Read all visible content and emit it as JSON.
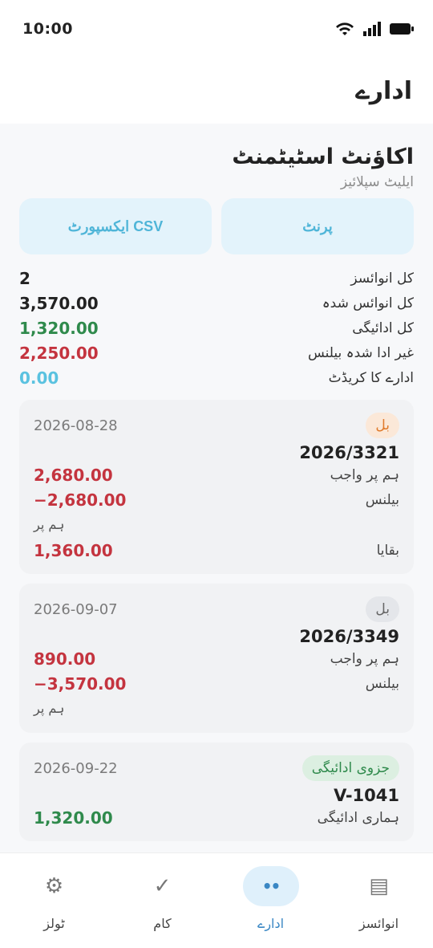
{
  "status": {
    "time": "10:00"
  },
  "app": {
    "title": "ادارے"
  },
  "statement": {
    "title": "اکاؤنٹ اسٹیٹمنٹ",
    "subtitle": "ایلیٹ سپلائیز",
    "print_label": "پرنٹ",
    "csv_label": "CSV ایکسپورٹ"
  },
  "summary": [
    {
      "label": "کل انوائسز",
      "value": "2",
      "color": "#222222"
    },
    {
      "label": "کل انوائس شدہ",
      "value": "3,570.00",
      "color": "#222222"
    },
    {
      "label": "کل ادائیگی",
      "value": "1,320.00",
      "color": "#2f8a4c"
    },
    {
      "label": "غیر ادا شدہ بیلنس",
      "value": "2,250.00",
      "color": "#c4343f"
    },
    {
      "label": "ادارے کا کریڈٹ",
      "value": "0.00",
      "color": "#5ac2e0"
    }
  ],
  "cards": [
    {
      "date": "2026-08-28",
      "badge": "بل",
      "badge_bg": "#fbe8d8",
      "badge_color": "#e07a2c",
      "number": "2026/3321",
      "rows": [
        {
          "label": "ہم پر واجب",
          "value": "2,680.00"
        },
        {
          "label": "بیلنس",
          "value": "−2,680.00"
        }
      ],
      "note": "ہم پر",
      "remaining_label": "بقایا",
      "remaining_value": "1,360.00"
    },
    {
      "date": "2026-09-07",
      "badge": "بل",
      "badge_bg": "#e4e6ea",
      "badge_color": "#666666",
      "number": "2026/3349",
      "rows": [
        {
          "label": "ہم پر واجب",
          "value": "890.00"
        },
        {
          "label": "بیلنس",
          "value": "−3,570.00"
        }
      ],
      "note": "ہم پر"
    },
    {
      "date": "2026-09-22",
      "badge": "جزوی ادائیگی",
      "badge_bg": "#dcefe1",
      "badge_color": "#2f8a4c",
      "number": "V-1041",
      "rows": [
        {
          "label": "ہماری ادائیگی",
          "value": "1,320.00"
        }
      ]
    }
  ],
  "nav": [
    {
      "label": "ٹولز",
      "icon": "gear-icon",
      "glyph": "⚙"
    },
    {
      "label": "کام",
      "icon": "check-icon",
      "glyph": "✓"
    },
    {
      "label": "ادارے",
      "icon": "entity-icon",
      "glyph": "••",
      "active": true
    },
    {
      "label": "انوائسز",
      "icon": "list-icon",
      "glyph": "▤"
    }
  ]
}
